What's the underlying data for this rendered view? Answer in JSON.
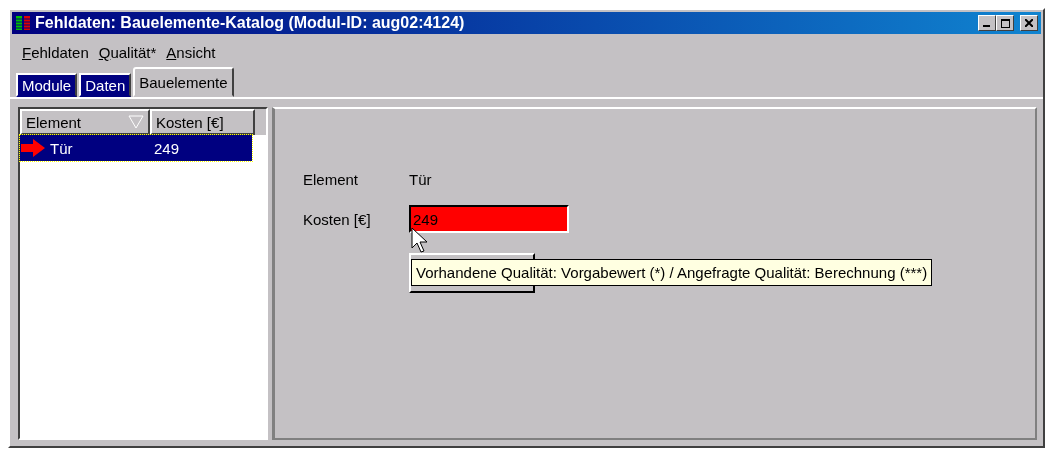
{
  "window": {
    "title": "Fehldaten: Bauelemente-Katalog (Modul-ID: aug02:4124)"
  },
  "menu": [
    {
      "label": "Fehldaten",
      "first_letter_underlined": true
    },
    {
      "label": "Qualität*",
      "first_letter_underlined": true
    },
    {
      "label": "Ansicht",
      "first_letter_underlined": true
    }
  ],
  "tabs": [
    {
      "label": "Module",
      "selected": false
    },
    {
      "label": "Daten",
      "selected": false
    },
    {
      "label": "Bauelemente",
      "selected": true
    }
  ],
  "list": {
    "columns": [
      {
        "label": "Element",
        "sorted": true
      },
      {
        "label": "Kosten [€]",
        "sorted": false
      }
    ],
    "rows": [
      {
        "cells": [
          "Tür",
          "249"
        ],
        "selected": true
      }
    ]
  },
  "form": {
    "fields": [
      {
        "kind": "text",
        "label": "Element",
        "value": "Tür"
      },
      {
        "kind": "input",
        "label": "Kosten [€]",
        "value": "249",
        "warning": true
      }
    ]
  },
  "tooltip": "Vorhandene Qualität: Vorgabewert (*) / Angefragte Qualität: Berechnung (***)"
}
